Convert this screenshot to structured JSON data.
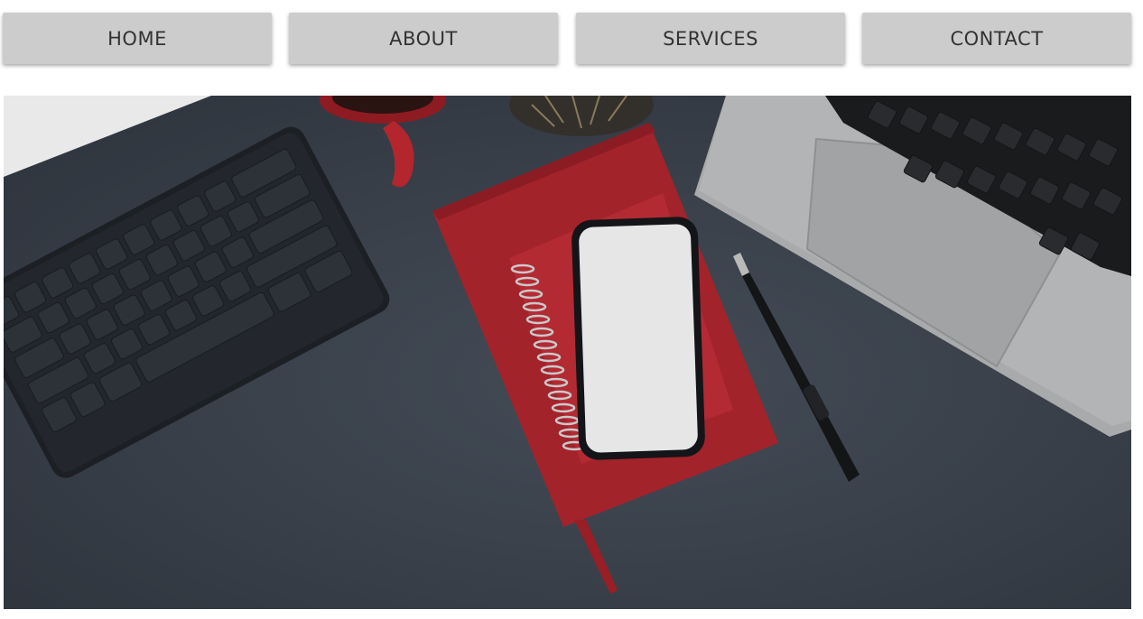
{
  "nav": {
    "items": [
      {
        "label": "HOME"
      },
      {
        "label": "ABOUT"
      },
      {
        "label": "SERVICES"
      },
      {
        "label": "CONTACT"
      }
    ]
  },
  "hero": {
    "image_name": "desk-flatlay-hero-image"
  },
  "colors": {
    "nav_background": "#cccccc",
    "nav_text": "#333333",
    "desk": "#3a414b",
    "notebook_red": "#a3232b"
  }
}
